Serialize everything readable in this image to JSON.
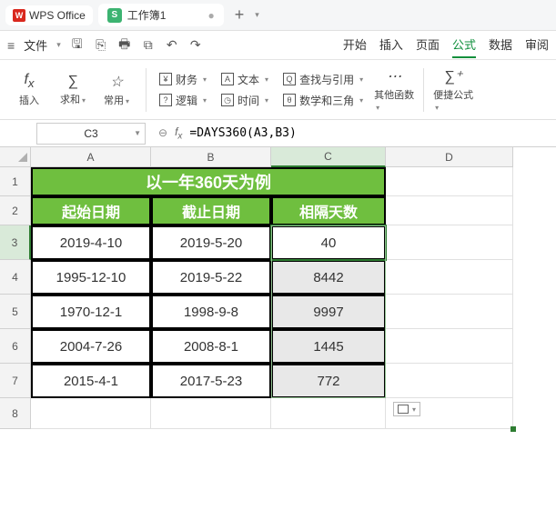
{
  "app": {
    "name": "WPS Office",
    "doc_title": "工作簿1"
  },
  "menubar": {
    "file": "文件"
  },
  "tabs": {
    "start": "开始",
    "insert": "插入",
    "page": "页面",
    "formula": "公式",
    "data": "数据",
    "review": "审阅"
  },
  "ribbon": {
    "insert_fn": "插入",
    "autosum": "求和",
    "common": "常用",
    "finance": "财务",
    "logic": "逻辑",
    "text": "文本",
    "datetime": "时间",
    "lookup": "查找与引用",
    "math": "数学和三角",
    "more": "其他函数",
    "quick": "便捷公式"
  },
  "namebox": "C3",
  "formula": "=DAYS360(A3,B3)",
  "colLabels": [
    "A",
    "B",
    "C",
    "D"
  ],
  "rowLabels": [
    "1",
    "2",
    "3",
    "4",
    "5",
    "6",
    "7",
    "8"
  ],
  "table": {
    "title": "以一年360天为例",
    "h1": "起始日期",
    "h2": "截止日期",
    "h3": "相隔天数",
    "rows": [
      {
        "a": "2019-4-10",
        "b": "2019-5-20",
        "c": "40"
      },
      {
        "a": "1995-12-10",
        "b": "2019-5-22",
        "c": "8442"
      },
      {
        "a": "1970-12-1",
        "b": "1998-9-8",
        "c": "9997"
      },
      {
        "a": "2004-7-26",
        "b": "2008-8-1",
        "c": "1445"
      },
      {
        "a": "2015-4-1",
        "b": "2017-5-23",
        "c": "772"
      }
    ]
  }
}
